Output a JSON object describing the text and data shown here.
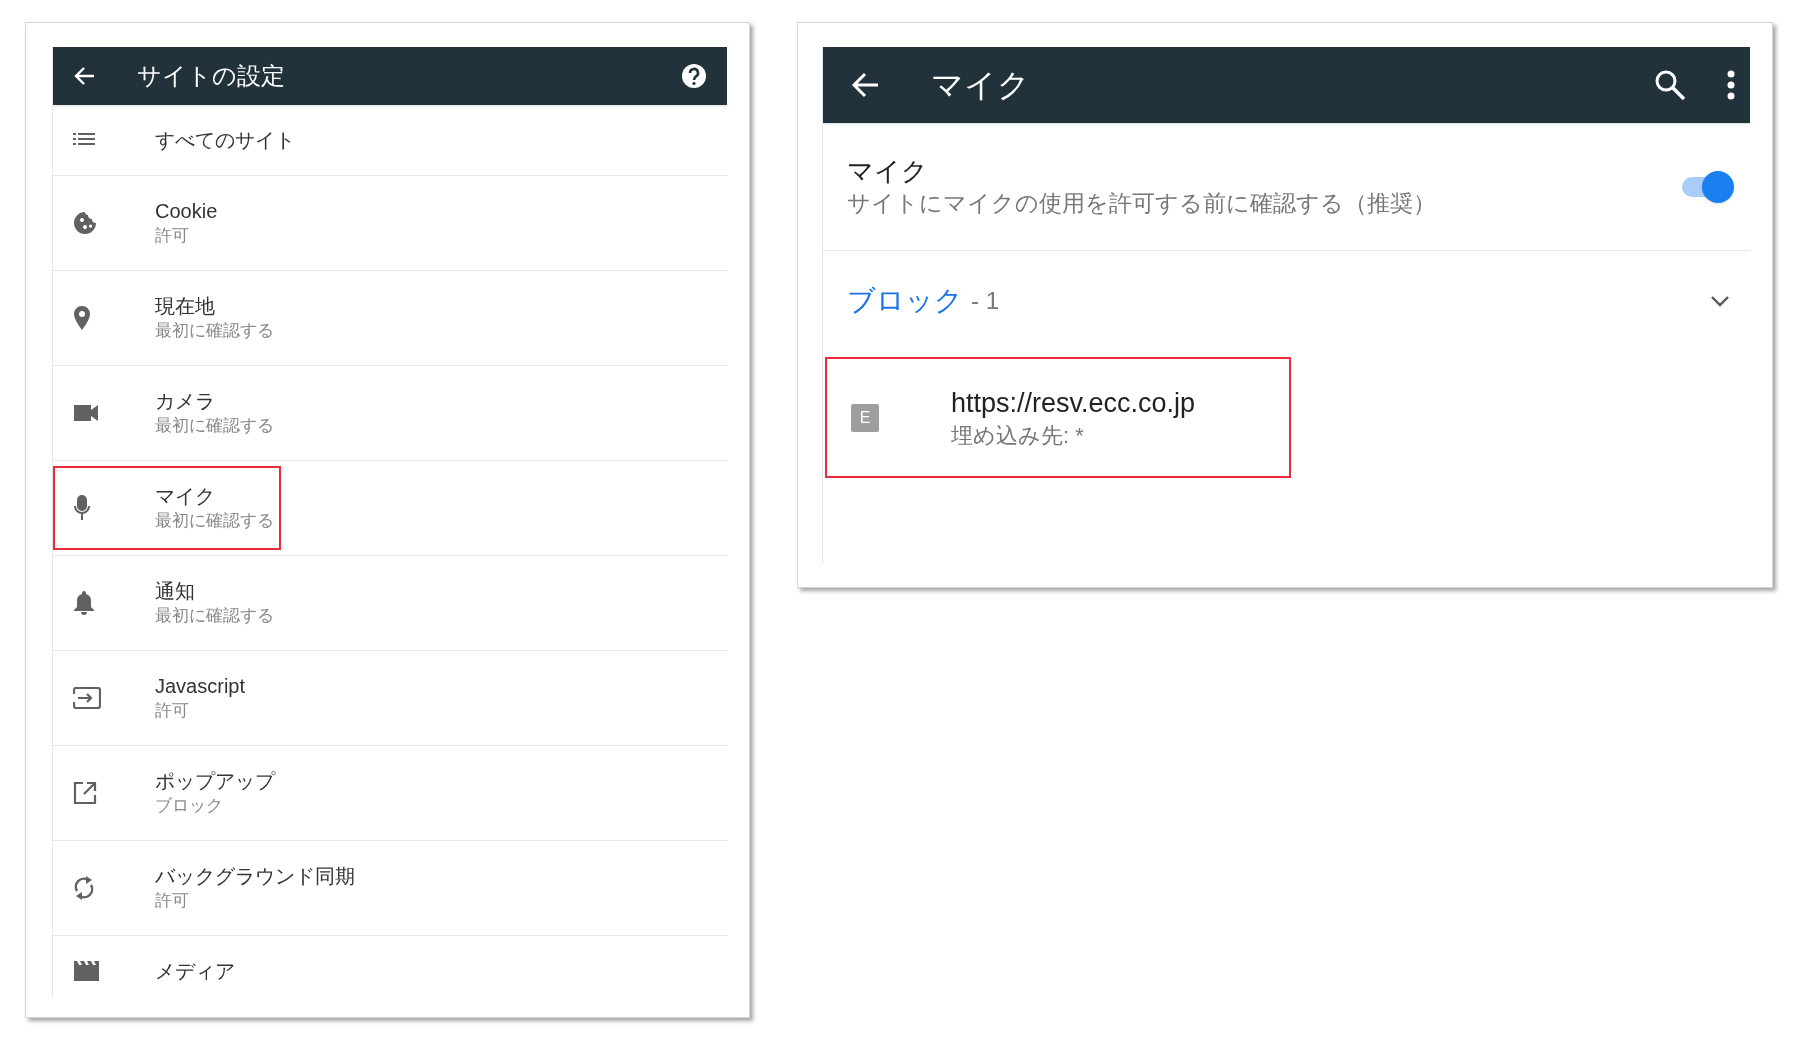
{
  "site_settings": {
    "title": "サイトの設定",
    "items": [
      {
        "kind": "list",
        "label": "すべてのサイト",
        "highlighted": false
      },
      {
        "kind": "cookie",
        "label": "Cookie",
        "status": "許可",
        "highlighted": false
      },
      {
        "kind": "location",
        "label": "現在地",
        "status": "最初に確認する",
        "highlighted": false
      },
      {
        "kind": "camera",
        "label": "カメラ",
        "status": "最初に確認する",
        "highlighted": false
      },
      {
        "kind": "mic",
        "label": "マイク",
        "status": "最初に確認する",
        "highlighted": true
      },
      {
        "kind": "bell",
        "label": "通知",
        "status": "最初に確認する",
        "highlighted": false
      },
      {
        "kind": "script",
        "label": "Javascript",
        "status": "許可",
        "highlighted": false
      },
      {
        "kind": "popup",
        "label": "ポップアップ",
        "status": "ブロック",
        "highlighted": false
      },
      {
        "kind": "sync",
        "label": "バックグラウンド同期",
        "status": "許可",
        "highlighted": false
      },
      {
        "kind": "media",
        "label": "メディア",
        "highlighted": false
      }
    ]
  },
  "mic_settings": {
    "title": "マイク",
    "toggle": {
      "label": "マイク",
      "description": "サイトにマイクの使用を許可する前に確認する（推奨）",
      "on": true
    },
    "blocked": {
      "label": "ブロック",
      "count": "- 1",
      "sites": [
        {
          "badge": "E",
          "url": "https://resv.ecc.co.jp",
          "embedded": "埋め込み先: *",
          "highlighted": true
        }
      ]
    }
  }
}
